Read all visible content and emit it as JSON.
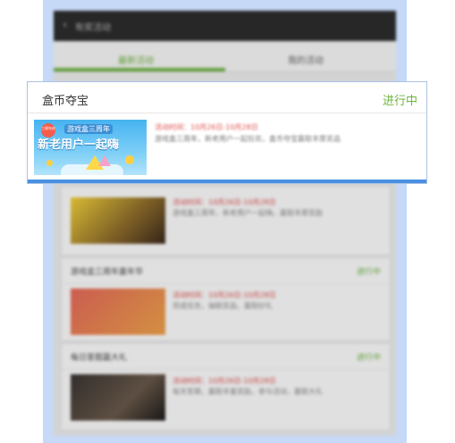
{
  "background_app": {
    "title": "有奖活动",
    "tabs": [
      "最新活动",
      "我的活动"
    ],
    "cards": [
      {
        "name": "",
        "status": "",
        "date": "活动时间：10月26日-10月28日",
        "desc": "游戏盒三周年，新老用户一起嗨，赢取丰厚奖励"
      },
      {
        "name": "游戏盒三周年嘉年华",
        "status": "进行中",
        "date": "活动时间：10月26日-10月28日",
        "desc": "完成任务，抽取奖品，赢取好礼"
      },
      {
        "name": "每日答题赢大礼",
        "status": "进行中",
        "date": "活动时间：10月26日-10月28日",
        "desc": "每天答题，赢取丰富奖励，参与活动，赢取大礼"
      }
    ]
  },
  "popup": {
    "title": "盒币夺宝",
    "status": "进行中",
    "banner": {
      "badge": "三周年庆",
      "subtitle": "游戏盒三周年",
      "headline": "新老用户一起嗨"
    },
    "date": "活动时间：10月26日-10月28日",
    "desc": "游戏盒三周年，新老用户一起狂欢，盒币夺宝赢取丰厚奖品"
  },
  "colors": {
    "accent_green": "#6db33f",
    "highlight_blue": "#4a90e2",
    "frame_blue": "#c6d9f7"
  }
}
